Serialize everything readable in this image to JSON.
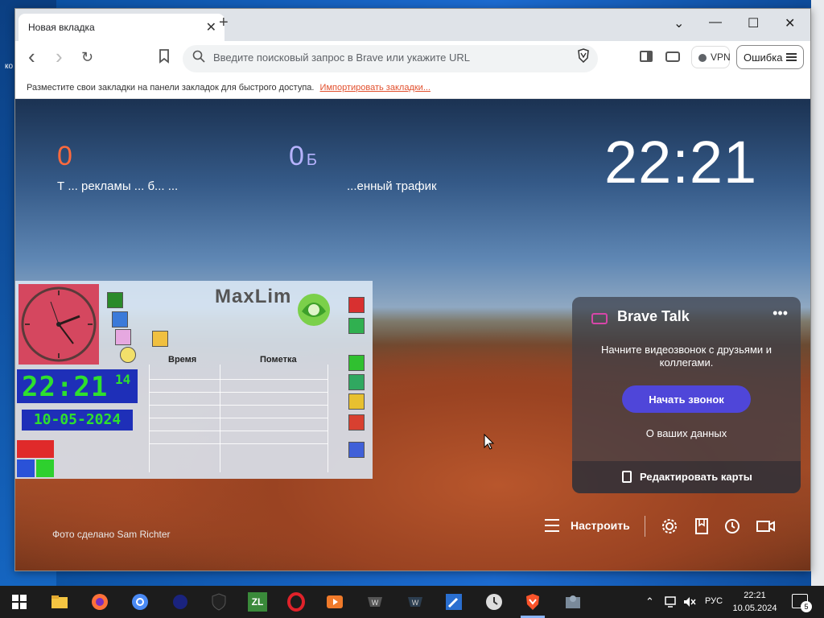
{
  "desktop": {
    "fragment": "ко"
  },
  "browser": {
    "tab_title": "Новая вкладка",
    "tab_close": "✕",
    "new_tab": "+",
    "window_buttons": {
      "dropdown": "⌄",
      "minimize": "—",
      "maximize": "☐",
      "close": "✕"
    },
    "nav": {
      "back": "‹",
      "forward": "›",
      "reload": "↻"
    },
    "search_placeholder": "Введите поисковый запрос в Brave или укажите URL",
    "vpn_label": "VPN",
    "error_label": "Ошибка",
    "bookmarks_bar_text": "Разместите свои закладки на панели закладок для быстрого доступа.",
    "bookmarks_import_link": "Импортировать закладки..."
  },
  "ntp": {
    "stats": [
      {
        "value": "0",
        "unit": "",
        "label": "Т  ... рекламы ... б... ...",
        "color": "#ff6a3d"
      },
      {
        "value": "0",
        "unit": "Б",
        "label": "...енный трафик",
        "color": "#b7b3ff"
      }
    ],
    "clock": "22:21",
    "photo_credit": "Фото сделано Sam Richter",
    "brave_talk": {
      "title": "Brave Talk",
      "more": "•••",
      "description": "Начните видеозвонок с друзьями и коллегами.",
      "start_button": "Начать звонок",
      "privacy_link": "О ваших данных",
      "edit_cards": "Редактировать карты"
    },
    "customize_label": "Настроить"
  },
  "maxlim": {
    "logo_text": "MaxLim",
    "time": "22:21",
    "seconds": "14",
    "date": "10-05-2024",
    "columns": {
      "time": "Время",
      "note": "Пометка"
    },
    "clock_color": "#d5475f",
    "digital_bg": "#1e2fb8",
    "digital_fg": "#2ee02e"
  },
  "taskbar": {
    "lang": "РУС",
    "time": "22:21",
    "date": "10.05.2024",
    "notification_count": "5",
    "icons": [
      "start-icon",
      "file-explorer-icon",
      "firefox-icon",
      "chromium-icon",
      "app-dark-blue-icon",
      "app-shield-icon",
      "zl-icon",
      "opera-icon",
      "media-player-icon",
      "world-of-tanks-icon",
      "world-of-warships-icon",
      "tool-icon",
      "clock-app-icon",
      "brave-icon",
      "settings-app-icon"
    ]
  },
  "colors": {
    "accent_purple": "#4f46d9",
    "brave_orange": "#fb542b"
  }
}
